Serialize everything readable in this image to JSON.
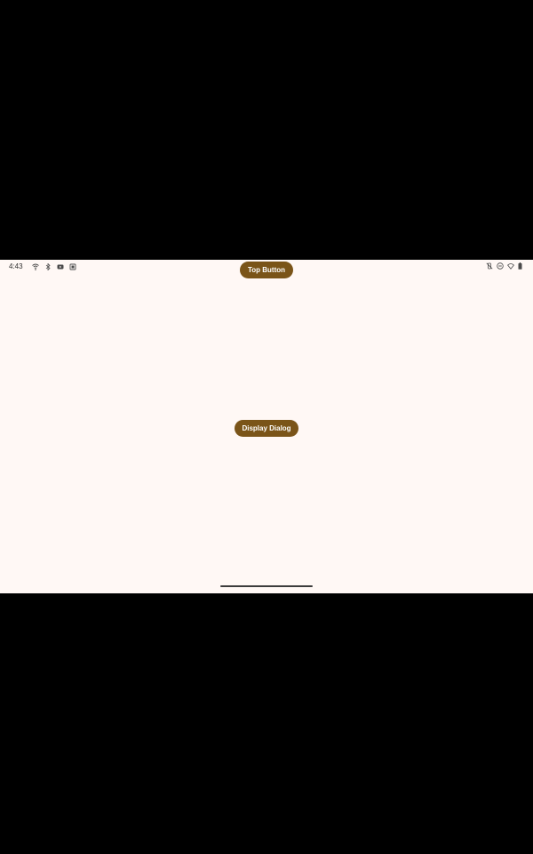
{
  "status_bar": {
    "time": "4:43",
    "left_icons": [
      "wifi-calling-icon",
      "bluetooth-icon",
      "youtube-icon",
      "screenshot-icon"
    ],
    "right_icons": [
      "vibrate-off-icon",
      "do-not-disturb-icon",
      "signal-icon",
      "battery-icon"
    ]
  },
  "main": {
    "top_button_label": "Top Button",
    "display_dialog_label": "Display Dialog"
  },
  "colors": {
    "background": "#fff8f5",
    "button": "#7a5418",
    "button_text": "#ffffff"
  }
}
